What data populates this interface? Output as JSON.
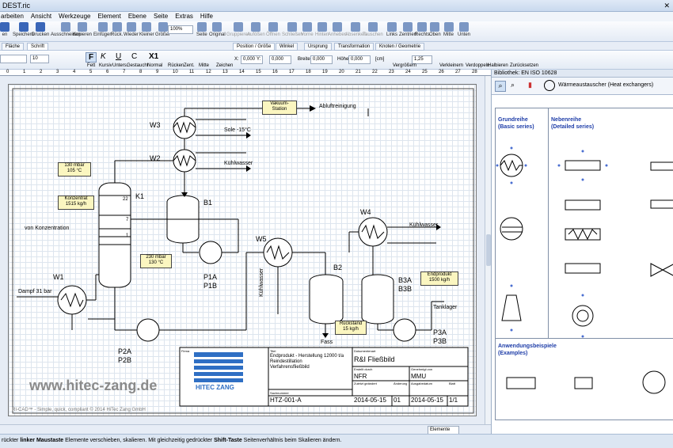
{
  "window": {
    "title": "DEST.ric"
  },
  "menu": [
    "arbeiten",
    "Ansicht",
    "Werkzeuge",
    "Element",
    "Ebene",
    "Seite",
    "Extras",
    "Hilfe"
  ],
  "toolbar1": [
    "en",
    "Speichern",
    "Drucken",
    "Ausschneiden",
    "Kopieren",
    "Einfügen",
    "Rück.",
    "Wieder",
    "Kleiner",
    "Größer",
    "Seite",
    "Original",
    "Gruppieren",
    "Aufößen",
    "Öffnen",
    "Schließen",
    "Vorne",
    "Hinten",
    "Anheben",
    "Absenken",
    "Tauschen",
    "Links",
    "Zentriert",
    "Rechts",
    "Oben",
    "Mitte",
    "Unten"
  ],
  "zoom": "100%",
  "tabs_left": [
    "Fläche",
    "Schrift"
  ],
  "tabs_right": [
    "Position / Größe",
    "Winkel",
    "Ursprung",
    "Transformation",
    "Knoten / Geometrie"
  ],
  "toolbar2": {
    "font_size": "10",
    "bold_label": "Fett",
    "italic_label": "Kursiv",
    "underline_label": "Unters.",
    "spaced_label": "Gestaucht",
    "normal_label": "Normal",
    "x1": "X1",
    "buttons": [
      "Rücken",
      "Zent.",
      "Mitte",
      "Zeichen"
    ],
    "x_val": "0,000",
    "y_val": "0,000",
    "breite_label": "Breite",
    "breite_val": "0,000",
    "hoehe_label": "Höhe",
    "hoehe_val": "0,000",
    "unit": "[cm]",
    "angle": "1,25",
    "right_buttons": [
      "Vergrößern",
      "Verkleinern",
      "Verdoppeln",
      "Halbieren",
      "Zurücksetzen"
    ]
  },
  "ruler": [
    "0",
    "1",
    "2",
    "3",
    "4",
    "5",
    "6",
    "7",
    "8",
    "9",
    "10",
    "11",
    "12",
    "13",
    "14",
    "15",
    "16",
    "17",
    "18",
    "19",
    "20",
    "21",
    "22",
    "23",
    "24",
    "25",
    "26",
    "27",
    "28"
  ],
  "drawing": {
    "labels": {
      "W3": "W3",
      "W2": "W2",
      "K1": "K1",
      "B1": "B1",
      "W4": "W4",
      "W5": "W5",
      "B2": "B2",
      "B3": "B3A\nB3B",
      "W1": "W1",
      "P1": "P1A\nP1B",
      "P2": "P2A\nP2B",
      "P3": "P3A\nP3B"
    },
    "notes": {
      "vakuum": "Vakuum-\nStation",
      "mbar1": "130 mbar\n105 °C",
      "konz": "Konzentrat\n1515 kg/h",
      "mbar2": "230 mbar\n130 °C",
      "rueck": "Rückstand\n15 kg/h",
      "endprod": "Endprodukt\n1500 kg/h"
    },
    "texts": {
      "abluft": "Abluftreinigung",
      "sole": "Sole -15°C",
      "kuehl1": "Kühlwasser",
      "kuehl2": "Kühlwasser",
      "kuehl3": "Kühlwasser",
      "vonkonz": "von Konzentration",
      "dampf": "Dampf 31 bar",
      "fass": "Fass",
      "tank": "Tanklager",
      "tray22": "22",
      "tray7": "7",
      "tray1": "1"
    },
    "url": "www.hitec-zang.de",
    "copyright": "RI-CAD™ - Simple, quick, compliant © 2014 HiTec Zang GmbH"
  },
  "titleblock": {
    "firma": "Firma",
    "titel_h": "Titel",
    "titel": "Endprodukt - Herstellung 12000 t/a\nReindestillation\nVerfahrensfließbild",
    "dokart_h": "Dokumentenart",
    "dokart": "R&I Fließbild",
    "erstellt_h": "Erstellt durch",
    "erstellt": "NFR",
    "gen_h": "Genehmigt von",
    "gen": "MMU",
    "sach_h": "Sachnummer",
    "sach": "HTZ-001-A",
    "zul_h": "Zuletzt geändert",
    "zul": "2014-05-15",
    "aend_h": "Änderung",
    "aend": "01",
    "ausg_h": "Ausgabedatum",
    "ausg": "2014-05-15",
    "blatt_h": "Blatt",
    "blatt": "1/1",
    "logo": "HITEC ZANG"
  },
  "hscroll": {
    "elements": "Elemente"
  },
  "status": {
    "p1": "rückter ",
    "b1": "linker Maustaste",
    "p2": " Elemente verschieben, skalieren. Mit gleichzeitig gedrückter ",
    "b2": "Shift-Taste",
    "p3": " Seitenverhältnis beim Skalieren ändern."
  },
  "library": {
    "title": "Bibliothek: EN ISO 10628",
    "selected": "Wärmeaustauscher (Heat exchangers)",
    "grund": "Grundreihe\n(Basic series)",
    "neben": "Nebenreihe\n(Detailed series)",
    "anwend": "Anwendungsbeispiele\n(Examples)"
  }
}
